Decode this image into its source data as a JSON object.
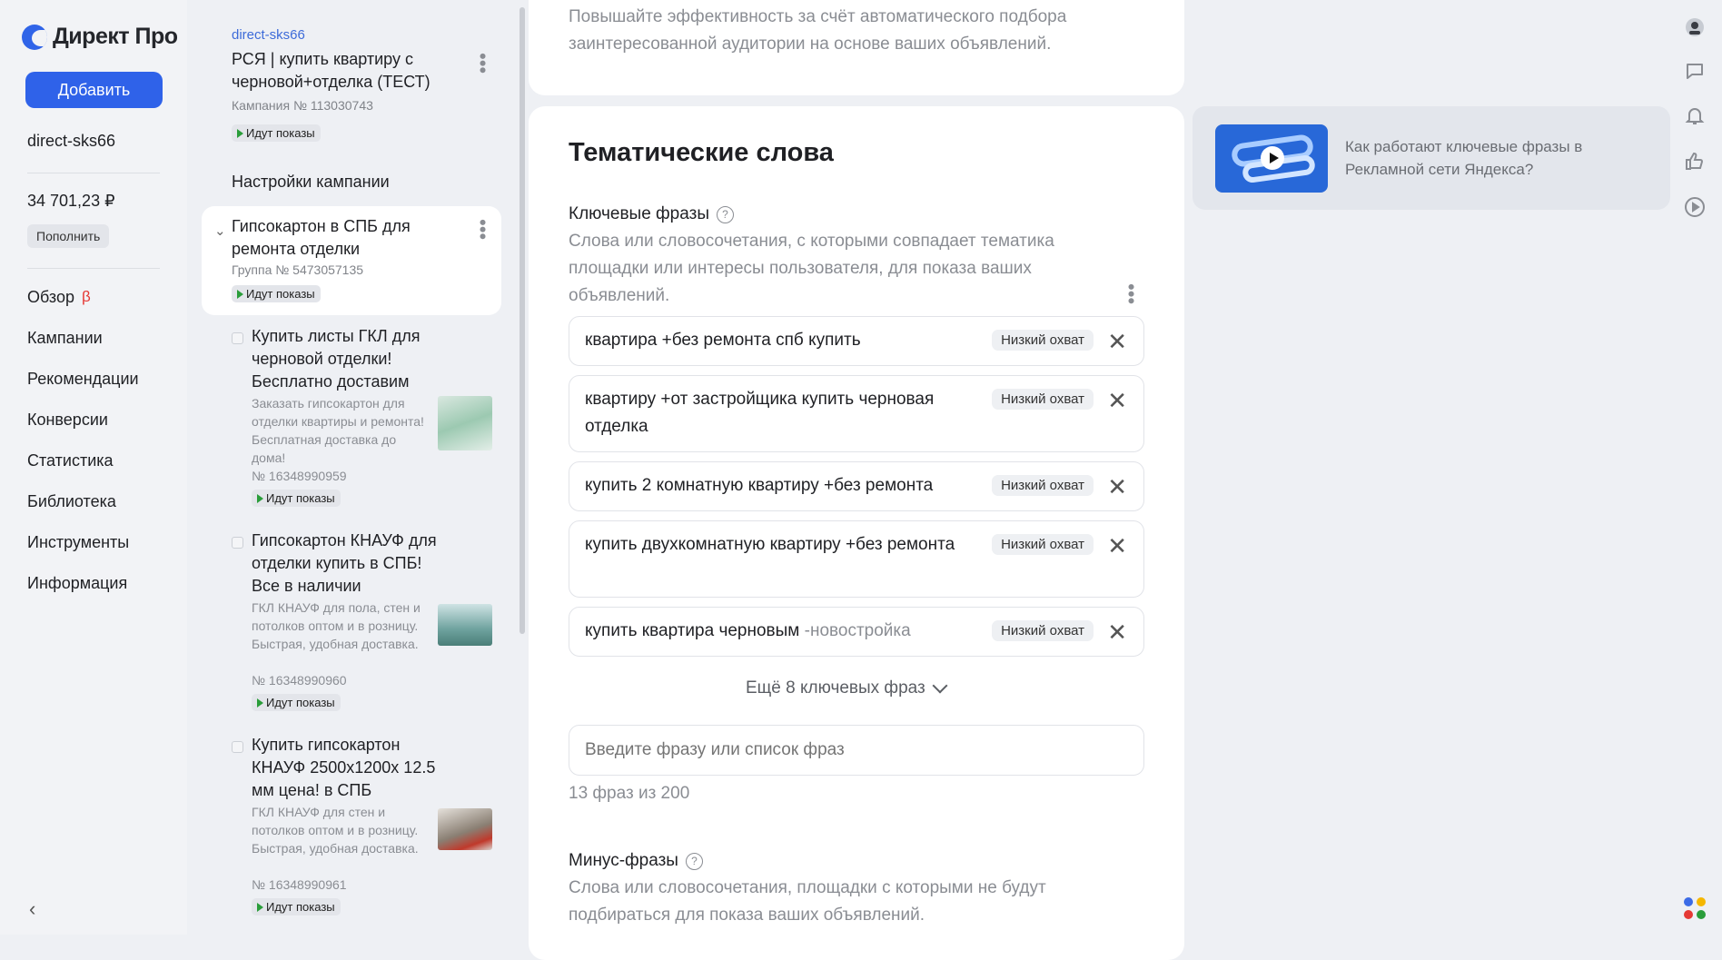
{
  "sidebar": {
    "logo": "Директ Про",
    "add_label": "Добавить",
    "user": "direct-sks66",
    "balance": "34 701,23 ₽",
    "topup_label": "Пополнить",
    "nav": [
      {
        "label": "Обзор",
        "badge": "β"
      },
      {
        "label": "Кампании"
      },
      {
        "label": "Рекомендации"
      },
      {
        "label": "Конверсии"
      },
      {
        "label": "Статистика"
      },
      {
        "label": "Библиотека"
      },
      {
        "label": "Инструменты"
      },
      {
        "label": "Информация"
      }
    ]
  },
  "campaign": {
    "login": "direct-sks66",
    "title": "РСЯ | купить квартиру с черновой+отделка (ТЕСТ)",
    "number": "Кампания № 113030743",
    "status": "Идут показы",
    "settings_label": "Настройки кампании"
  },
  "group": {
    "title": "Гипсокартон в СПБ для ремонта отделки",
    "number": "Группа № 5473057135",
    "status": "Идут показы"
  },
  "ads": [
    {
      "title": "Купить листы ГКЛ для черновой отделки! Бесплатно доставим",
      "desc": "Заказать гипсокартон для отделки квартиры и ремонта! Бесплатная доставка до дома!",
      "number": "№ 16348990959",
      "status": "Идут показы"
    },
    {
      "title": "Гипсокартон КНАУФ для отделки купить в СПБ!Все в наличии",
      "desc": "ГКЛ КНАУФ для пола, стен и потолков оптом и в розницу. Быстрая, удобная доставка.",
      "number": "№ 16348990960",
      "status": "Идут показы"
    },
    {
      "title": "Купить гипсокартон КНАУФ 2500x1200x 12.5 мм цена! в СПБ",
      "desc": "ГКЛ КНАУФ для стен и потолков оптом и в розницу. Быстрая, удобная доставка.",
      "number": "№ 16348990961",
      "status": "Идут показы"
    }
  ],
  "main": {
    "top_text": "Повышайте эффективность за счёт автоматического подбора заинтересованной аудитории на основе ваших объявлений.",
    "section_title": "Тематические слова",
    "keywords_label": "Ключевые фразы",
    "keywords_desc": "Слова или словосочетания, с которыми совпадает тематика площадки или интересы пользователя, для показа ваших объявлений.",
    "phrases": [
      {
        "text": "квартира +без ремонта спб купить",
        "neg": "",
        "badge": "Низкий охват"
      },
      {
        "text": "квартиру +от застройщика купить черновая отделка",
        "neg": "",
        "badge": "Низкий охват"
      },
      {
        "text": "купить 2 комнатную квартиру +без ремонта",
        "neg": "",
        "badge": "Низкий охват"
      },
      {
        "text": "купить двухкомнатную квартиру +без ремонта",
        "neg": "",
        "badge": "Низкий охват"
      },
      {
        "text": "купить квартира черновым ",
        "neg": "-новостройка",
        "badge": "Низкий охват"
      }
    ],
    "more_label": "Ещё 8 ключевых фраз",
    "input_placeholder": "Введите фразу или список фраз",
    "counter": "13 фраз из 200",
    "minus_label": "Минус-фразы",
    "minus_desc": "Слова или словосочетания, площадки с которыми не будут подбираться для показа ваших объявлений."
  },
  "help": {
    "text": "Как работают ключевые фразы в Рекламной сети Яндекса?"
  }
}
